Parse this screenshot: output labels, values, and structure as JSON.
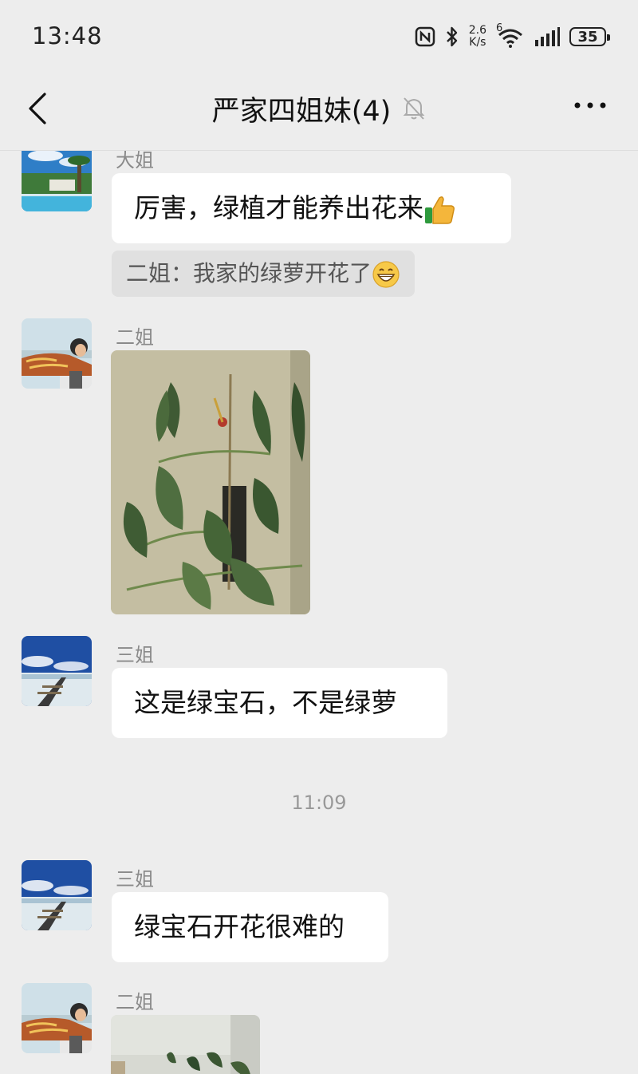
{
  "status_bar": {
    "time": "13:48",
    "net_speed_value": "2.6",
    "net_speed_unit": "K/s",
    "wifi_label": "6",
    "battery": "35"
  },
  "header": {
    "title": "严家四姐妹(4)",
    "back_icon": "chevron-left-icon",
    "mute_icon": "bell-off-icon",
    "more_icon": "more-dots-icon"
  },
  "messages": [
    {
      "sender": "大姐",
      "text": "厉害，绿植才能养出花来",
      "emoji": "thumbs-up-emoji",
      "quote": "二姐：我家的绿萝开花了",
      "quote_emoji": "grinning-emoji"
    },
    {
      "sender": "二姐",
      "type": "image",
      "image": "philodendron-plant-photo"
    },
    {
      "sender": "三姐",
      "text": "这是绿宝石，不是绿萝"
    },
    {
      "type": "timestamp",
      "text": "11:09"
    },
    {
      "sender": "三姐",
      "text": "绿宝石开花很难的"
    },
    {
      "sender": "二姐",
      "type": "image",
      "image": "plant-photo-partial"
    }
  ],
  "colors": {
    "background": "#ededed",
    "bubble": "#ffffff",
    "quote": "#e0e0e0",
    "name_text": "#8a8a8a"
  }
}
